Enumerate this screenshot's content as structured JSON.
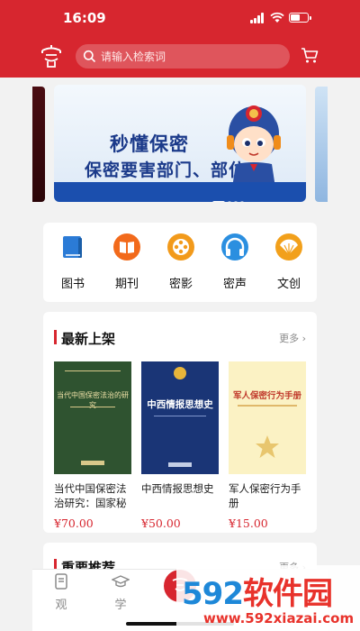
{
  "status_bar": {
    "time": "16:09"
  },
  "header": {
    "search_placeholder": "请输入检索词"
  },
  "banner": {
    "line1": "秒懂保密",
    "line2": "保密要害部门、部位"
  },
  "categories": [
    {
      "label": "图书",
      "icon": "book-icon",
      "color": "#2b7bd6"
    },
    {
      "label": "期刊",
      "icon": "journal-icon",
      "color": "#f26a1b"
    },
    {
      "label": "密影",
      "icon": "film-reel-icon",
      "color": "#f29a1b"
    },
    {
      "label": "密声",
      "icon": "headphones-icon",
      "color": "#2b8fe0"
    },
    {
      "label": "文创",
      "icon": "fan-icon",
      "color": "#f2a01b"
    }
  ],
  "new_arrivals": {
    "title": "最新上架",
    "more": "更多",
    "books": [
      {
        "title": "当代中国保密法治研究：国家秘密...",
        "price": "¥70.00",
        "cover_title": "当代中国保密法治的研究"
      },
      {
        "title": "中西情报思想史",
        "price": "¥50.00",
        "cover_title": "中西情报思想史"
      },
      {
        "title": "军人保密行为手册",
        "price": "¥15.00",
        "cover_title": "军人保密行为手册"
      }
    ]
  },
  "recommended": {
    "title": "重要推荐",
    "more": "更多"
  },
  "tabbar": {
    "tab1": "观",
    "tab2": "学"
  },
  "watermark": {
    "brand_a": "592",
    "brand_b": "软件园",
    "url": "www.592xiazai.com"
  },
  "colors": {
    "brand_red": "#d7262f",
    "price_red": "#d7262f"
  }
}
